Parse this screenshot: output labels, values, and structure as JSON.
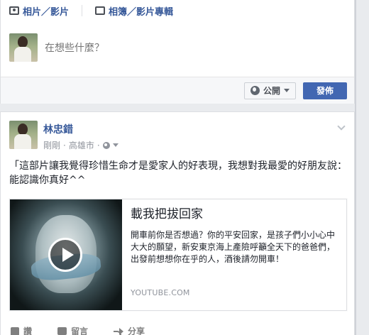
{
  "composer": {
    "tabs": [
      {
        "label": "相片／影片",
        "icon": "camera-icon"
      },
      {
        "label": "相簿／影片專輯",
        "icon": "album-icon"
      }
    ],
    "placeholder": "在想些什麼？",
    "audience_label": "公開",
    "post_label": "發佈"
  },
  "post": {
    "author": "林忠錯",
    "time": "剛剛",
    "location": "高雄市",
    "text": "「這部片讓我覺得珍惜生命才是愛家人的好表現，我想對我最愛的好朋友說：能認識你真好^^",
    "link": {
      "title": "載我把拔回家",
      "description": "開車前你是否想過？你的平安回家，是孩子們小小心中 大大的願望，新安東京海上產險呼籲全天下的爸爸們，出發前想想你在乎的人，酒後請勿開車！",
      "source": "YOUTUBE.COM"
    },
    "actions": {
      "like": "讚",
      "comment": "留言",
      "share": "分享"
    }
  },
  "colors": {
    "brand": "#4267b2",
    "link": "#365899",
    "background": "#e9ebee"
  }
}
